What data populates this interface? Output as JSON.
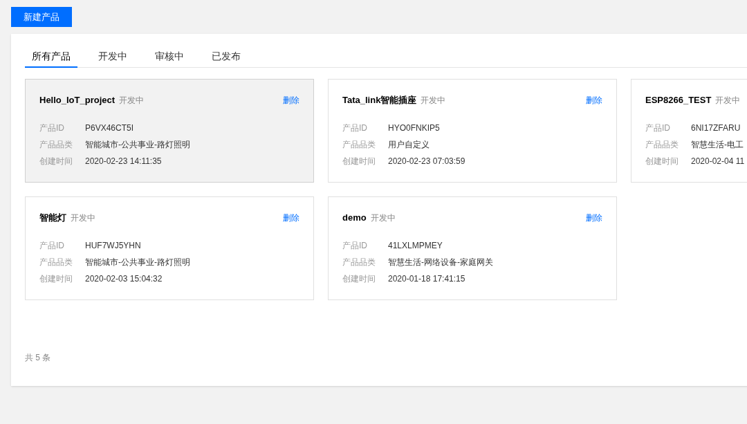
{
  "new_button": "新建产品",
  "tabs": [
    {
      "label": "所有产品",
      "selected": true
    },
    {
      "label": "开发中",
      "selected": false
    },
    {
      "label": "审核中",
      "selected": false
    },
    {
      "label": "已发布",
      "selected": false
    }
  ],
  "products": [
    {
      "name": "Hello_IoT_project",
      "status": "开发中",
      "delete": "删除",
      "hovered": true,
      "fields": [
        {
          "label": "产品ID",
          "value": "P6VX46CT5I"
        },
        {
          "label": "产品品类",
          "value": "智能城市-公共事业-路灯照明"
        },
        {
          "label": "创建时间",
          "value": "2020-02-23 14:11:35"
        }
      ]
    },
    {
      "name": "Tata_link智能插座",
      "status": "开发中",
      "delete": "删除",
      "hovered": false,
      "fields": [
        {
          "label": "产品ID",
          "value": "HYO0FNKIP5"
        },
        {
          "label": "产品品类",
          "value": "用户自定义"
        },
        {
          "label": "创建时间",
          "value": "2020-02-23 07:03:59"
        }
      ]
    },
    {
      "name": "ESP8266_TEST",
      "status": "开发中",
      "hovered": false,
      "fields": [
        {
          "label": "产品ID",
          "value": "6NI17ZFARU"
        },
        {
          "label": "产品品类",
          "value": "智慧生活-电工"
        },
        {
          "label": "创建时间",
          "value": "2020-02-04 11"
        }
      ]
    },
    {
      "name": "智能灯",
      "status": "开发中",
      "delete": "删除",
      "hovered": false,
      "fields": [
        {
          "label": "产品ID",
          "value": "HUF7WJ5YHN"
        },
        {
          "label": "产品品类",
          "value": "智能城市-公共事业-路灯照明"
        },
        {
          "label": "创建时间",
          "value": "2020-02-03 15:04:32"
        }
      ]
    },
    {
      "name": "demo",
      "status": "开发中",
      "delete": "删除",
      "hovered": false,
      "fields": [
        {
          "label": "产品ID",
          "value": "41LXLMPMEY"
        },
        {
          "label": "产品品类",
          "value": "智慧生活-网络设备-家庭网关"
        },
        {
          "label": "创建时间",
          "value": "2020-01-18 17:41:15"
        }
      ]
    }
  ],
  "total": "共 5 条"
}
